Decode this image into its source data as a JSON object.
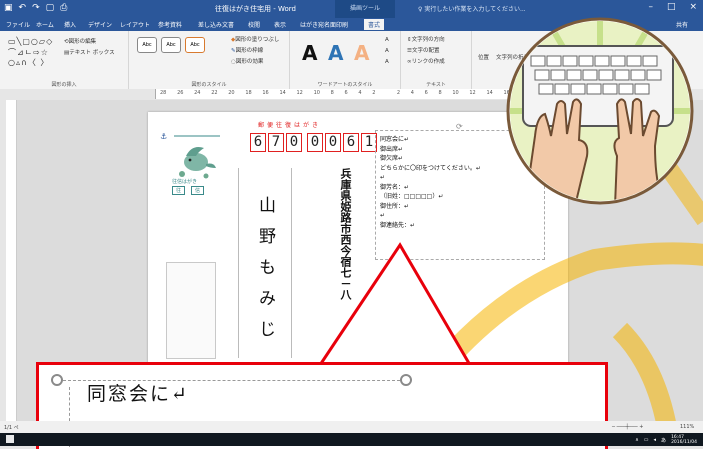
{
  "titlebar": {
    "title": "往復はがき住宅用 - Word",
    "context_tab": "描画ツール",
    "search": "実行したい作業を入力してください...",
    "user": "共有"
  },
  "tabs": [
    "ファイル",
    "ホーム",
    "挿入",
    "デザイン",
    "レイアウト",
    "参考資料",
    "差し込み文書",
    "校閲",
    "表示",
    "はがき宛名面印刷",
    "書式"
  ],
  "active_tab": "書式",
  "ribbon": {
    "insert_shapes_label": "図形の挿入",
    "edit_shape": "図形の編集",
    "textbox": "テキスト ボックス",
    "shape_styles_label": "図形のスタイル",
    "style_samples": [
      "Abc",
      "Abc",
      "Abc"
    ],
    "shape_fill": "図形の塗りつぶし",
    "shape_outline": "図形の枠線",
    "shape_effects": "図形の効果",
    "wordart_label": "ワードアートのスタイル",
    "wordart_samples": [
      "A",
      "A",
      "A"
    ],
    "text_label": "テキスト",
    "text_direction": "文字列の方向",
    "text_align": "文字の配置",
    "link": "リンクの作成",
    "position": "位置",
    "wrap": "文字列の折り返し"
  },
  "ruler_numbers": [
    "28",
    "26",
    "24",
    "22",
    "20",
    "18",
    "16",
    "14",
    "12",
    "10",
    "8",
    "6",
    "4",
    "2",
    "",
    "2",
    "4",
    "6",
    "8",
    "10",
    "12",
    "14",
    "16"
  ],
  "postcard": {
    "header": "郵便往復はがき",
    "postal_code": [
      "6",
      "7",
      "0",
      "0",
      "0",
      "6",
      "1"
    ],
    "address": "兵庫県姫路市西今宿七－八",
    "name": "山野もみじ",
    "stamp_caption": "往信はがき",
    "stamp_labels": [
      "往",
      "信"
    ]
  },
  "reply_text": [
    "同窓会に↵",
    "御出席↵",
    "御欠席↵",
    "どちらかに〇印をつけてください。↵",
    "↵",
    "御芳名：↵",
    "（旧姓：□□□□□）↵",
    "御住所：↵",
    "↵",
    "御連絡先：↵"
  ],
  "callout_text": "同窓会に↵",
  "status": {
    "page": "1/1 ペ",
    "zoom": "111%"
  },
  "taskbar": {
    "ime": "あ",
    "time": "16:47",
    "date": "2016/11/04"
  },
  "colors": {
    "word_blue": "#2b579a",
    "accent_red": "#e8000b",
    "postal_red": "#e02020",
    "orange": "#f5b400"
  }
}
